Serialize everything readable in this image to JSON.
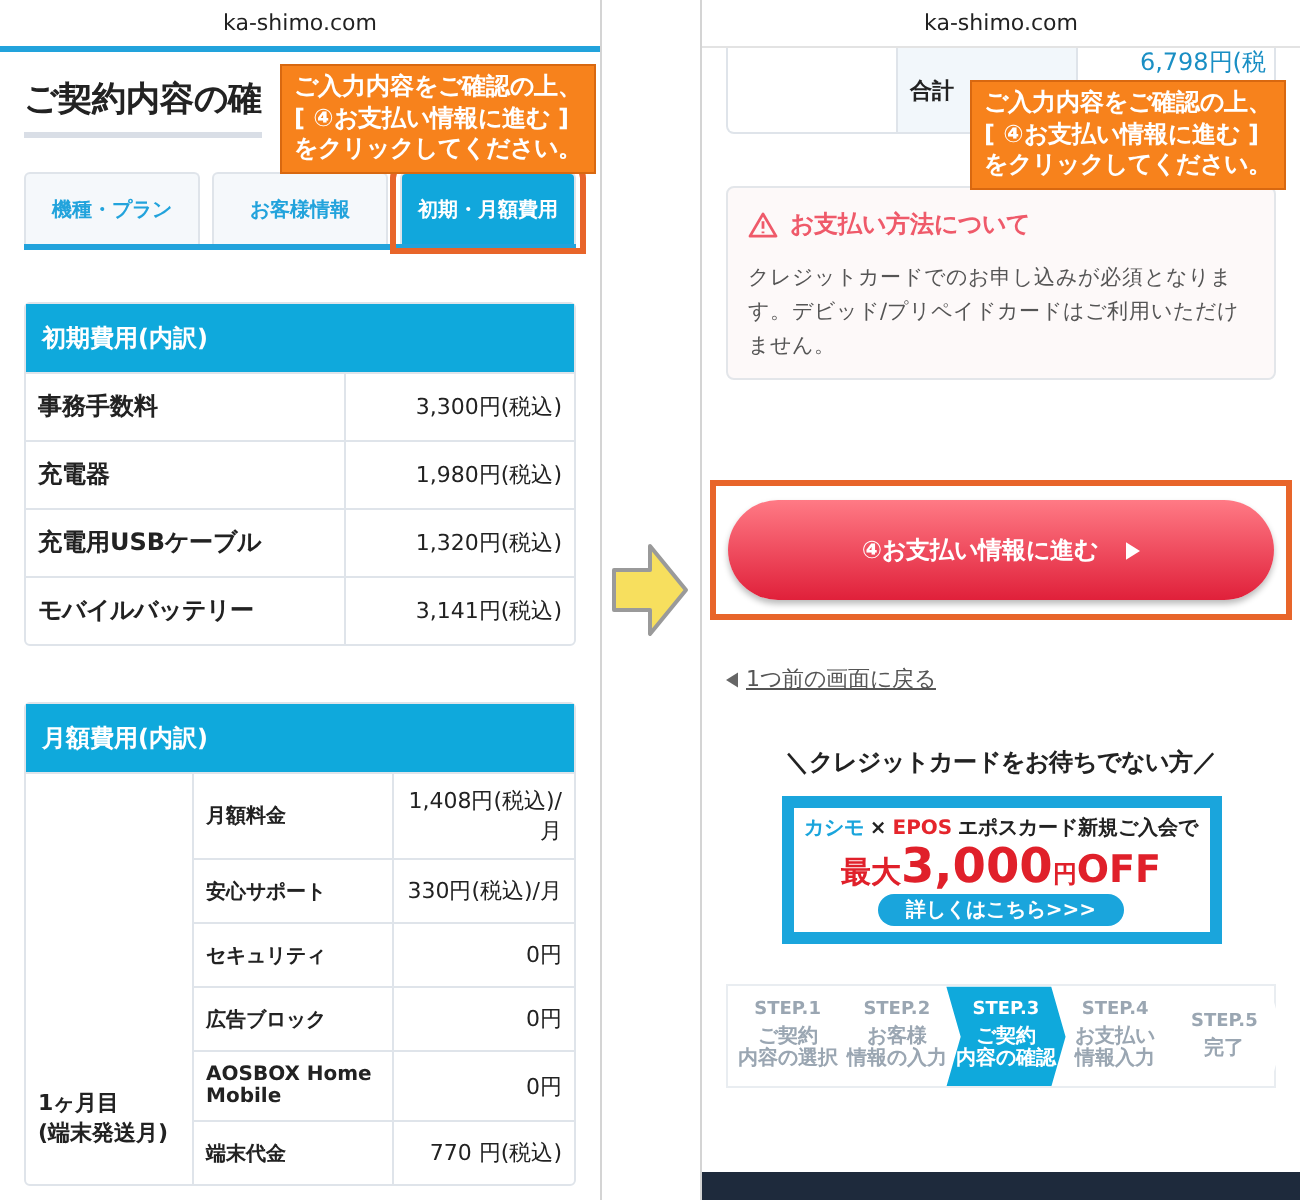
{
  "left_screen": {
    "url": "ka-shimo.com",
    "title": "ご契約内容の確",
    "callout": [
      "ご入力内容をご確認の上、",
      "[ ④お支払い情報に進む ]",
      "をクリックしてください。"
    ],
    "tabs": [
      {
        "label": "機種・プラン",
        "selected": false
      },
      {
        "label": "お客様情報",
        "selected": false
      },
      {
        "label": "初期・月額費用",
        "selected": true
      }
    ],
    "initial_fees": {
      "heading": "初期費用(内訳)",
      "rows": [
        {
          "item": "事務手数料",
          "price": "3,300円(税込)"
        },
        {
          "item": "充電器",
          "price": "1,980円(税込)"
        },
        {
          "item": "充電用USBケーブル",
          "price": "1,320円(税込)"
        },
        {
          "item": "モバイルバッテリー",
          "price": "3,141円(税込)"
        }
      ]
    },
    "monthly_fees": {
      "heading": "月額費用(内訳)",
      "period": [
        "1ヶ月目",
        "(端末発送月)"
      ],
      "rows": [
        {
          "item": "月額料金",
          "price": "1,408円(税込)/月"
        },
        {
          "item": "安心サポート",
          "price": "330円(税込)/月"
        },
        {
          "item": "セキュリティ",
          "price": "0円"
        },
        {
          "item": "広告ブロック",
          "price": "0円"
        },
        {
          "item": "AOSBOX Home Mobile",
          "price": "0円"
        },
        {
          "item": "端末代金",
          "price": "770 円(税込)"
        }
      ]
    }
  },
  "right_screen": {
    "url": "ka-shimo.com",
    "total_label": "合計",
    "total_price": "6,798円(税",
    "callout": [
      "ご入力内容をご確認の上、",
      "[ ④お支払い情報に進む ]",
      "をクリックしてください。"
    ],
    "notice": {
      "title": "お支払い方法について",
      "body": "クレジットカードでのお申し込みが必須となります。デビッド/プリペイドカードはご利用いただけません。"
    },
    "next_button": "④お支払い情報に進む",
    "back_link": "1つ前の画面に戻る",
    "promo_heading": "＼クレジットカードをお待ちでない方／",
    "banner": {
      "brand": "カシモ",
      "cross": "×",
      "partner": "EPOS",
      "tagline": "エポスカード新規ご入会で",
      "prefix": "最大",
      "amount": "3,000",
      "unit": "円",
      "suffix": "OFF",
      "button": "詳しくはこちら>>>"
    },
    "steps": [
      {
        "step": "STEP.1",
        "lines": [
          "ご契約",
          "内容の選択"
        ],
        "selected": false
      },
      {
        "step": "STEP.2",
        "lines": [
          "お客様",
          "情報の入力"
        ],
        "selected": false
      },
      {
        "step": "STEP.3",
        "lines": [
          "ご契約",
          "内容の確認"
        ],
        "selected": true
      },
      {
        "step": "STEP.4",
        "lines": [
          "お支払い",
          "情報入力"
        ],
        "selected": false
      },
      {
        "step": "STEP.5",
        "lines": [
          "完了"
        ],
        "selected": false
      }
    ]
  }
}
